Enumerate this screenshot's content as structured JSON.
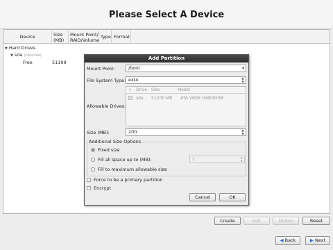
{
  "header": {
    "title": "Please Select A Device"
  },
  "table": {
    "columns": {
      "device": "Device",
      "size_1": "Size",
      "size_2": "(MB)",
      "mount_1": "Mount Point/",
      "mount_2": "RAID/Volume",
      "type": "Type",
      "format": "Format"
    },
    "tree": {
      "root": "Hard Drives",
      "disk": "sda",
      "disk_sub": "(/dev/sda)",
      "free_label": "Free",
      "free_size": "51199"
    }
  },
  "dialog": {
    "title": "Add Partition",
    "mount_point_label": "Mount Point:",
    "mount_point_value": "/boot",
    "fs_type_label": "File System Type:",
    "fs_type_value": "ext4",
    "allowable_drives_label": "Allowable Drives:",
    "drives_columns": {
      "check": "✓",
      "drive": "Drive",
      "size": "Size",
      "model": "Model"
    },
    "drives_row": {
      "drive": "sda",
      "size": "51200 MB",
      "model": "ATA VBOX HARDDISK"
    },
    "size_label": "Size (MB):",
    "size_value": "200",
    "additional_options_label": "Additional Size Options",
    "opt_fixed": "Fixed size",
    "opt_fill_upto": "Fill all space up to (MB):",
    "opt_fill_upto_value": "1",
    "opt_fill_max": "Fill to maximum allowable size",
    "force_primary": "Force to be a primary partition",
    "encrypt": "Encrypt",
    "cancel": "Cancel",
    "ok": "OK"
  },
  "bottom_buttons": {
    "create": "Create",
    "edit": "Edit",
    "delete": "Delete",
    "reset": "Reset"
  },
  "nav": {
    "back": "Back",
    "next": "Next"
  }
}
